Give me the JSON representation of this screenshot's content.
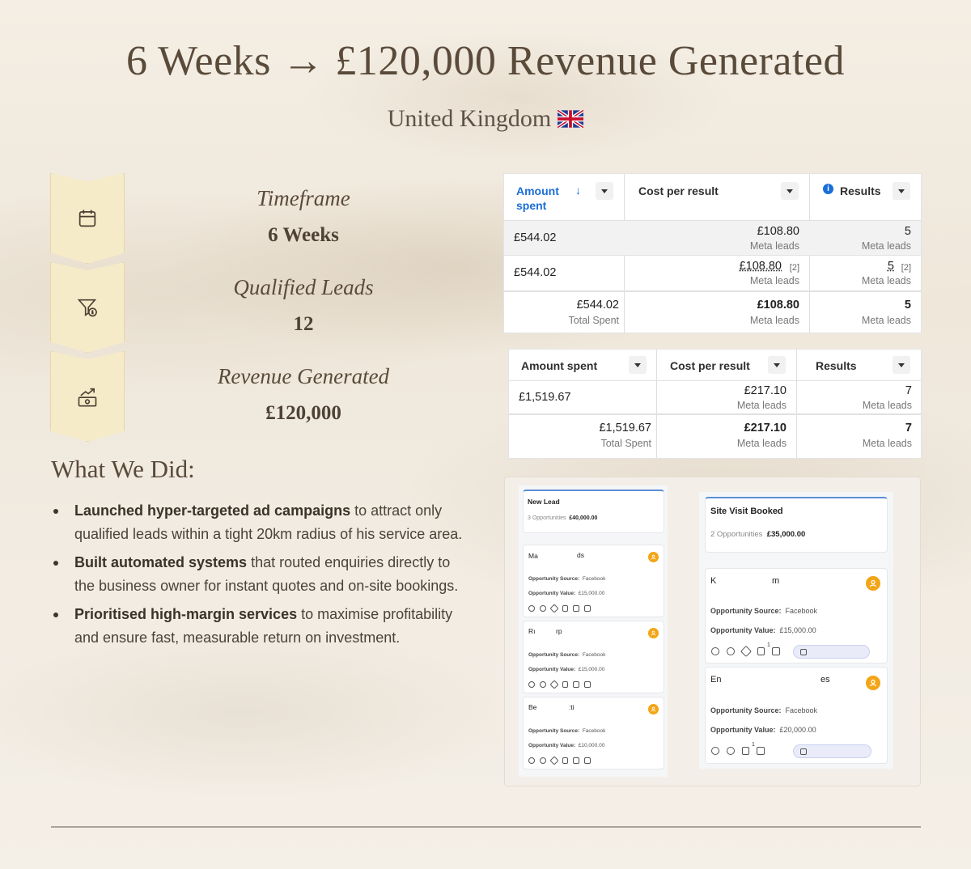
{
  "header": {
    "title": "6 Weeks → £120,000 Revenue Generated",
    "subtitle": "United Kingdom",
    "flag_icon": "uk-flag-icon"
  },
  "stats": [
    {
      "label": "Timeframe",
      "value": "6 Weeks",
      "icon": "calendar-icon"
    },
    {
      "label": "Qualified Leads",
      "value": "12",
      "icon": "funnel-money-icon"
    },
    {
      "label": "Revenue Generated",
      "value": "£120,000",
      "icon": "money-growth-icon"
    }
  ],
  "what_we_did": {
    "heading": "What We Did:",
    "items": [
      {
        "bold": "Launched hyper-targeted ad campaigns",
        "rest": " to attract only qualified leads within a tight 20km radius of his service area."
      },
      {
        "bold": "Built automated systems",
        "rest": " that routed enquiries directly to the business owner for instant quotes and on-site bookings."
      },
      {
        "bold": "Prioritised high-margin services",
        "rest": " to maximise profitability and ensure fast, measurable return on investment."
      }
    ]
  },
  "table1": {
    "headers": {
      "amount_a": "Amount",
      "amount_b": "spent",
      "sort_arrow": "↓",
      "cost": "Cost per result",
      "info": "i",
      "results": "Results"
    },
    "rows": [
      {
        "amount": "£544.02",
        "cost": "£108.80",
        "cost_sub": "Meta leads",
        "results": "5",
        "results_sub": "Meta leads"
      },
      {
        "amount": "£544.02",
        "cost": "£108.80",
        "cost_note": "[2]",
        "cost_sub": "Meta leads",
        "results": "5",
        "results_note": "[2]",
        "results_sub": "Meta leads"
      }
    ],
    "total": {
      "amount": "£544.02",
      "amount_sub": "Total Spent",
      "cost": "£108.80",
      "cost_sub": "Meta leads",
      "results": "5",
      "results_sub": "Meta leads"
    }
  },
  "table2": {
    "headers": {
      "amount": "Amount spent",
      "cost": "Cost per result",
      "results": "Results"
    },
    "row": {
      "amount": "£1,519.67",
      "cost": "£217.10",
      "cost_sub": "Meta leads",
      "results": "7",
      "results_sub": "Meta leads"
    },
    "total": {
      "amount": "£1,519.67",
      "amount_sub": "Total Spent",
      "cost": "£217.10",
      "cost_sub": "Meta leads",
      "results": "7",
      "results_sub": "Meta leads"
    }
  },
  "crm": {
    "stage1": {
      "title": "New Lead",
      "count": "3 Opportunities",
      "value": "£40,000.00",
      "cards": [
        {
          "name_a": "Ma",
          "name_b": "ds",
          "source_label": "Opportunity Source:",
          "source": "Facebook",
          "value_label": "Opportunity Value:",
          "value": "£15,000.00"
        },
        {
          "name_a": "Rı",
          "name_b": "rp",
          "source_label": "Opportunity Source:",
          "source": "Facebook",
          "value_label": "Opportunity Value:",
          "value": "£15,000.00"
        },
        {
          "name_a": "Be",
          "name_b": ":ti",
          "source_label": "Opportunity Source:",
          "source": "Facebook",
          "value_label": "Opportunity Value:",
          "value": "£10,000.00"
        }
      ]
    },
    "stage2": {
      "title": "Site Visit Booked",
      "count": "2 Opportunities",
      "value": "£35,000.00",
      "cards": [
        {
          "name_a": "K",
          "name_b": "m",
          "source_label": "Opportunity Source:",
          "source": "Facebook",
          "value_label": "Opportunity Value:",
          "value": "£15,000.00",
          "badge": "1"
        },
        {
          "name_a": "En",
          "name_b": "es",
          "source_label": "Opportunity Source:",
          "source": "Facebook",
          "value_label": "Opportunity Value:",
          "value": "£20,000.00",
          "badge": "1"
        }
      ]
    },
    "card_icons": [
      "phone-icon",
      "chat-icon",
      "tag-icon",
      "document-icon",
      "checkbox-icon",
      "calendar-icon"
    ],
    "accent": "#f2a516"
  }
}
